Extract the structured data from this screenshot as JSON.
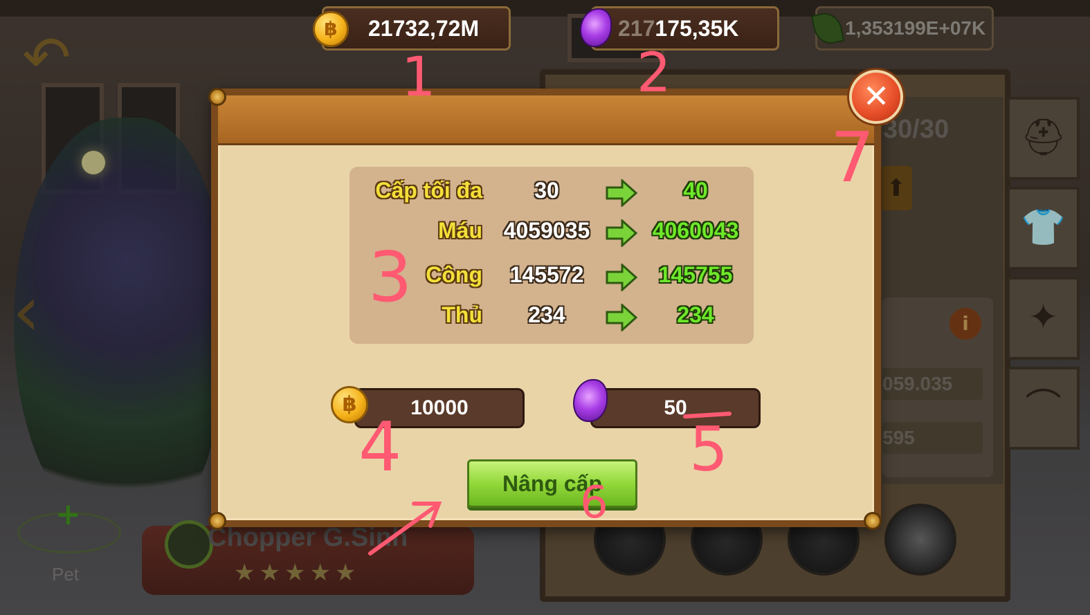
{
  "currencies": {
    "gold": {
      "value": "21732,72M",
      "icon": "gold-coin-icon"
    },
    "gem": {
      "ghost_text": "217",
      "value": "175,35K",
      "icon": "purple-gem-icon"
    },
    "leaf": {
      "value": "1,353199E+07K",
      "icon": "green-leaf-icon"
    }
  },
  "background": {
    "pet_label": "Pet",
    "hero_name": "Chopper G.Sinh",
    "hero_stars": "★★★★★",
    "level": "30/30",
    "stat_values": [
      "059.035",
      "595"
    ]
  },
  "dialog": {
    "stats": [
      {
        "label": "Cấp tối đa",
        "old": "30",
        "new": "40"
      },
      {
        "label": "Máu",
        "old": "4059035",
        "new": "4060043"
      },
      {
        "label": "Công",
        "old": "145572",
        "new": "145755"
      },
      {
        "label": "Thủ",
        "old": "234",
        "new": "234"
      }
    ],
    "cost_gold": "10000",
    "cost_gem": "50",
    "upgrade_label": "Nâng cấp",
    "close_label": "✕"
  },
  "annotations": [
    "1",
    "2",
    "3",
    "4",
    "5",
    "6",
    "7"
  ],
  "colors": {
    "accent_gold": "#f4df3a",
    "upgrade_green": "#6ee82a",
    "annotation_pink": "#ff5a72",
    "dialog_bg": "#e9d4a8",
    "close_red": "#e8502a"
  }
}
